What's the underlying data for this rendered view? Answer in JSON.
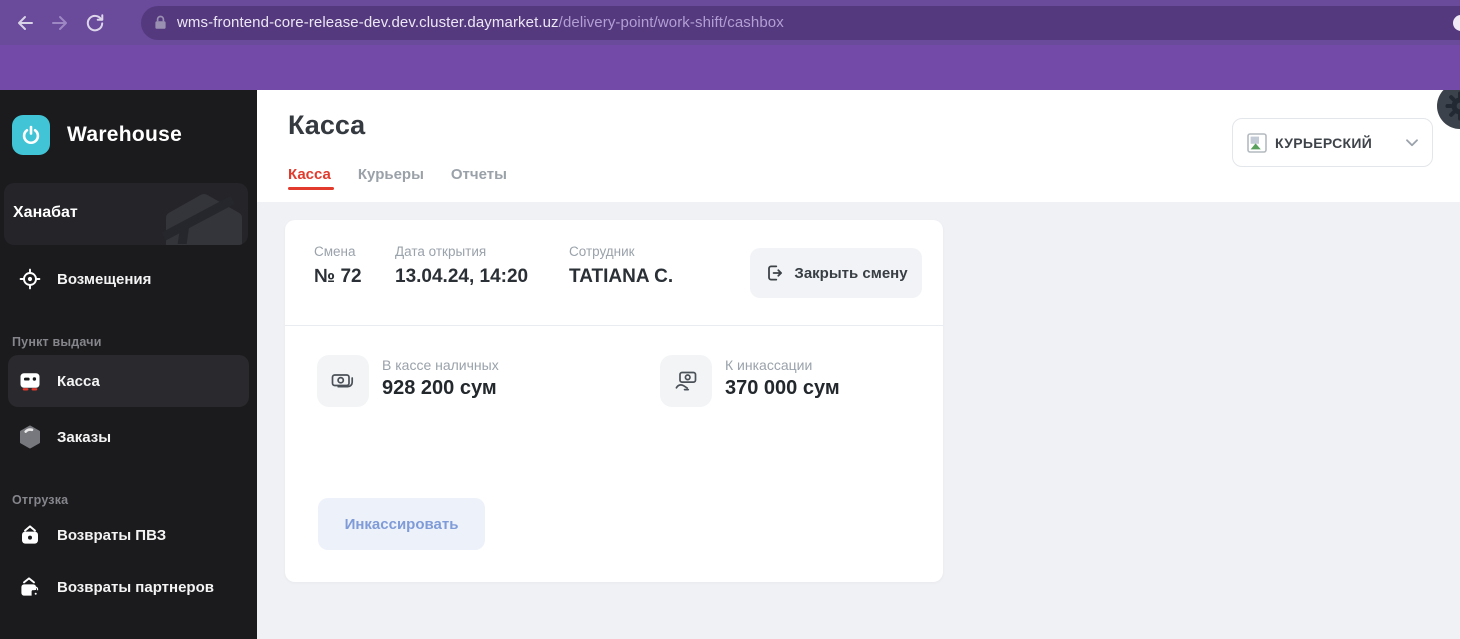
{
  "browser": {
    "url_host": "wms-frontend-core-release-dev.dev.cluster.daymarket.uz",
    "url_path": "/delivery-point/work-shift/cashbox"
  },
  "sidebar": {
    "brand": "Warehouse",
    "location": "Ханабат",
    "nav": {
      "reimbursements": "Возмещения",
      "section_pickup": "Пункт выдачи",
      "cashbox": "Касса",
      "orders": "Заказы",
      "section_shipping": "Отгрузка",
      "returns_pvz": "Возвраты ПВЗ",
      "returns_partners": "Возвраты партнеров"
    },
    "icons": [
      "target-icon",
      "cash-register-icon",
      "package-icon",
      "bag-icon",
      "wallet-icon",
      "power-icon",
      "box-silhouette-icon"
    ]
  },
  "header": {
    "title": "Касса",
    "tabs": [
      {
        "label": "Касса",
        "active": true
      },
      {
        "label": "Курьеры",
        "active": false
      },
      {
        "label": "Отчеты",
        "active": false
      }
    ],
    "delivery_type": "КУРЬЕРСКИЙ"
  },
  "shift_card": {
    "shift": {
      "label": "Смена",
      "value": "№ 72"
    },
    "opened": {
      "label": "Дата открытия",
      "value": "13.04.24, 14:20"
    },
    "employee": {
      "label": "Сотрудник",
      "value": "TATIANA C."
    },
    "close_shift_label": "Закрыть смену",
    "cash": {
      "label": "В кассе наличных",
      "value": "928 200 сум",
      "icon": "banknotes-icon"
    },
    "collection": {
      "label": "К инкассации",
      "value": "370 000 сум",
      "icon": "cash-collect-icon"
    },
    "collect_label": "Инкассировать"
  },
  "colors": {
    "chrome_toolbar": "#6a4a9b",
    "chrome_addressbar": "#55397f",
    "chrome_strip": "#744aa8",
    "sidebar_bg": "#1b1b1d",
    "brand_teal": "#41c4d6",
    "accent_red": "#e23b2e",
    "content_bg": "#f0f1f5",
    "muted_blue_button_text": "#7f9bd8",
    "cashbox_feet_red": "#e0392d"
  }
}
